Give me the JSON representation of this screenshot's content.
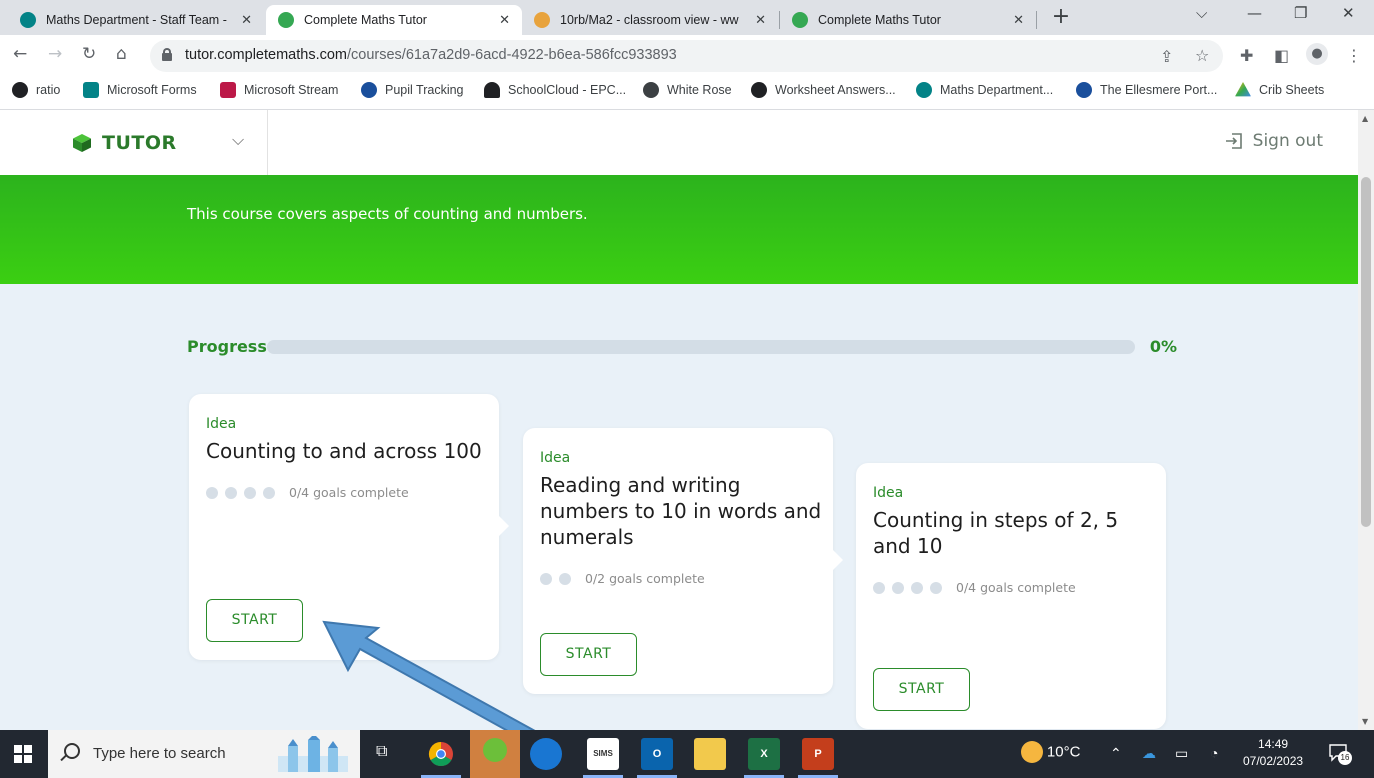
{
  "browser": {
    "tabs": [
      {
        "label": "Maths Department - Staff Team -",
        "active": false,
        "favicon_color": "#038387"
      },
      {
        "label": "Complete Maths Tutor",
        "active": true,
        "favicon_color": "#35a853"
      },
      {
        "label": "10rb/Ma2 - classroom view - ww",
        "active": false,
        "favicon_color": "#e8a33d"
      },
      {
        "label": "Complete Maths Tutor",
        "active": false,
        "favicon_color": "#35a853"
      }
    ],
    "url_host": "tutor.completemaths.com",
    "url_path": "/courses/61a7a2d9-6acd-4922-b6ea-586fcc933893",
    "bookmarks": [
      "ratio",
      "Microsoft Forms",
      "Microsoft Stream",
      "Pupil Tracking",
      "SchoolCloud - EPC...",
      "White Rose",
      "Worksheet Answers...",
      "Maths Department...",
      "The Ellesmere Port...",
      "Crib Sheets"
    ]
  },
  "app": {
    "logo_text": "TUTOR",
    "sign_out_label": "Sign out",
    "course_description": "This course covers aspects of counting and numbers.",
    "progress": {
      "label": "Progress",
      "value_text": "0%",
      "fraction": 0.0
    },
    "cards": [
      {
        "type": "Idea",
        "title": "Counting to and across 100",
        "goals_text": "0/4 goals complete",
        "goals_total": 4,
        "goals_done": 0,
        "button_label": "START"
      },
      {
        "type": "Idea",
        "title": "Reading and writing numbers to 10 in words and numerals",
        "goals_text": "0/2 goals complete",
        "goals_total": 2,
        "goals_done": 0,
        "button_label": "START"
      },
      {
        "type": "Idea",
        "title": "Counting in steps of 2, 5 and 10",
        "goals_text": "0/4 goals complete",
        "goals_total": 4,
        "goals_done": 0,
        "button_label": "START"
      }
    ],
    "colors": {
      "brand_green": "#2b8c2b",
      "hero_green": "#2cb31d",
      "page_bg": "#e9f1f8",
      "callout_arrow": "#5b9bd5"
    }
  },
  "taskbar": {
    "search_placeholder": "Type here to search",
    "weather": "10°C",
    "time": "14:49",
    "date": "07/02/2023",
    "notification_count": "16",
    "apps": [
      "chrome-icon",
      "app-green-icon",
      "edge-icon",
      "sims-icon",
      "outlook-icon",
      "file-explorer-icon",
      "excel-icon",
      "powerpoint-icon"
    ],
    "sims_label": "SIMS"
  }
}
